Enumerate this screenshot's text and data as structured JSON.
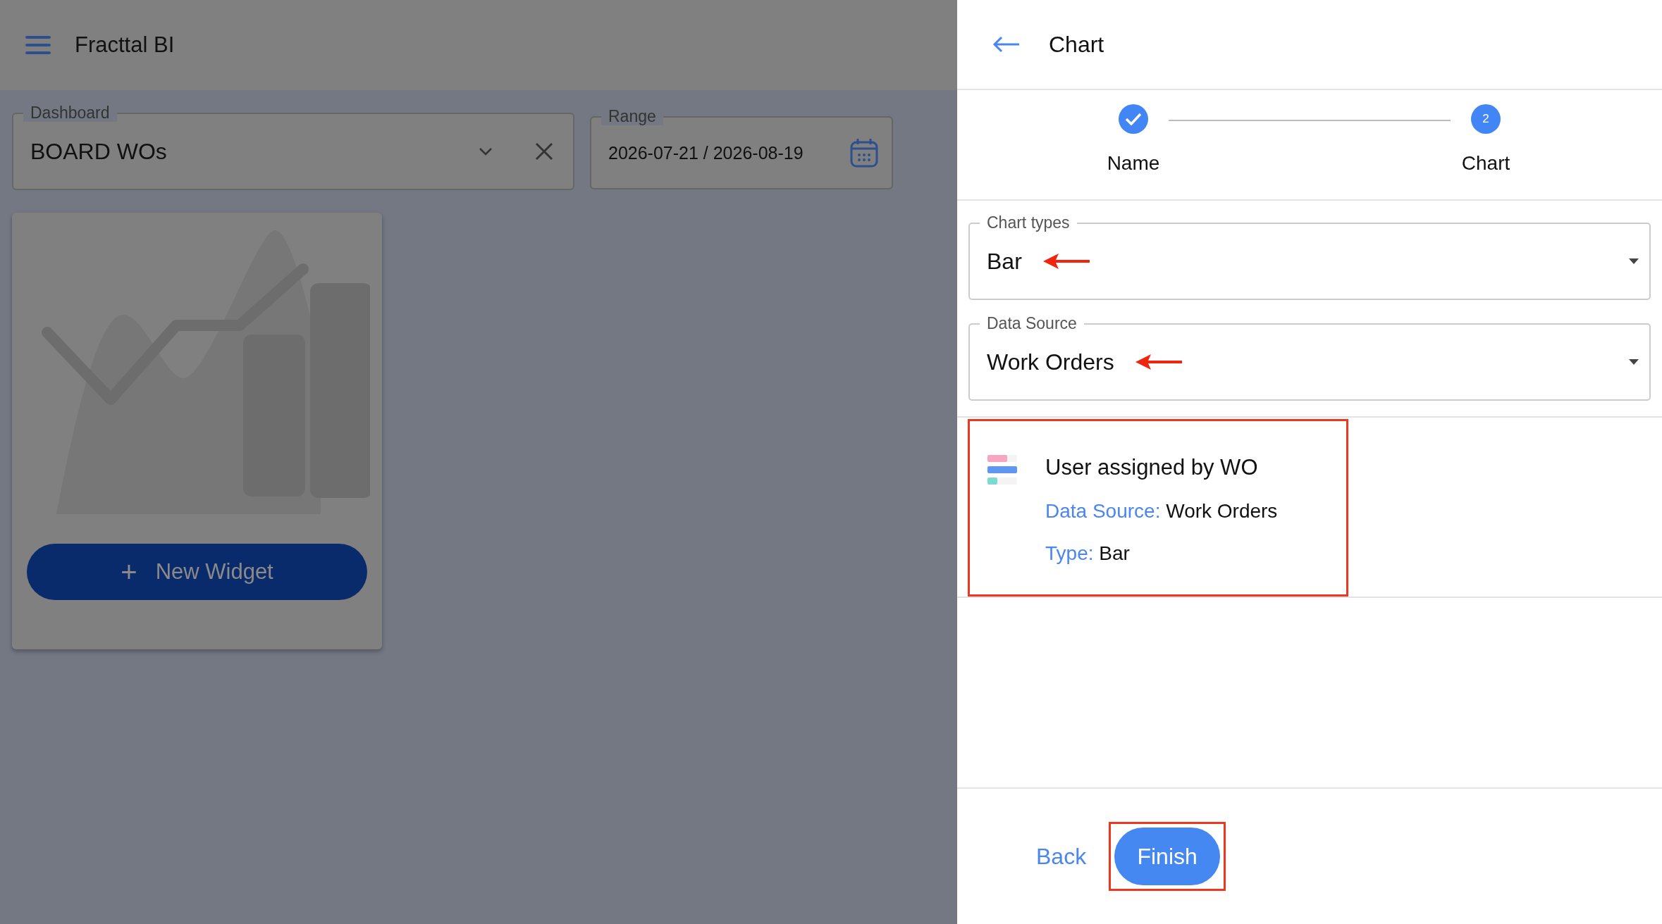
{
  "app_bar": {
    "title": "Fracttal BI"
  },
  "filters": {
    "dashboard": {
      "label": "Dashboard",
      "value": "BOARD WOs"
    },
    "range": {
      "label": "Range",
      "value": "2026-07-21 / 2026-08-19"
    }
  },
  "widget_card": {
    "button": "New Widget",
    "button_icon": "+"
  },
  "panel": {
    "title": "Chart",
    "steps": [
      {
        "label": "Name",
        "completed": true
      },
      {
        "label": "Chart",
        "completed": false,
        "number": "2"
      }
    ],
    "fields": [
      {
        "label": "Chart types",
        "value": "Bar",
        "annotated": true
      },
      {
        "label": "Data Source",
        "value": "Work Orders",
        "annotated": true
      }
    ],
    "summary": {
      "title": "User assigned by WO",
      "highlighted": true,
      "lines": [
        {
          "label": "Data Source:",
          "value": "Work Orders"
        },
        {
          "label": "Type:",
          "value": "Bar"
        }
      ]
    },
    "actions": {
      "back": "Back",
      "finish": "Finish",
      "finish_highlighted": true
    }
  }
}
